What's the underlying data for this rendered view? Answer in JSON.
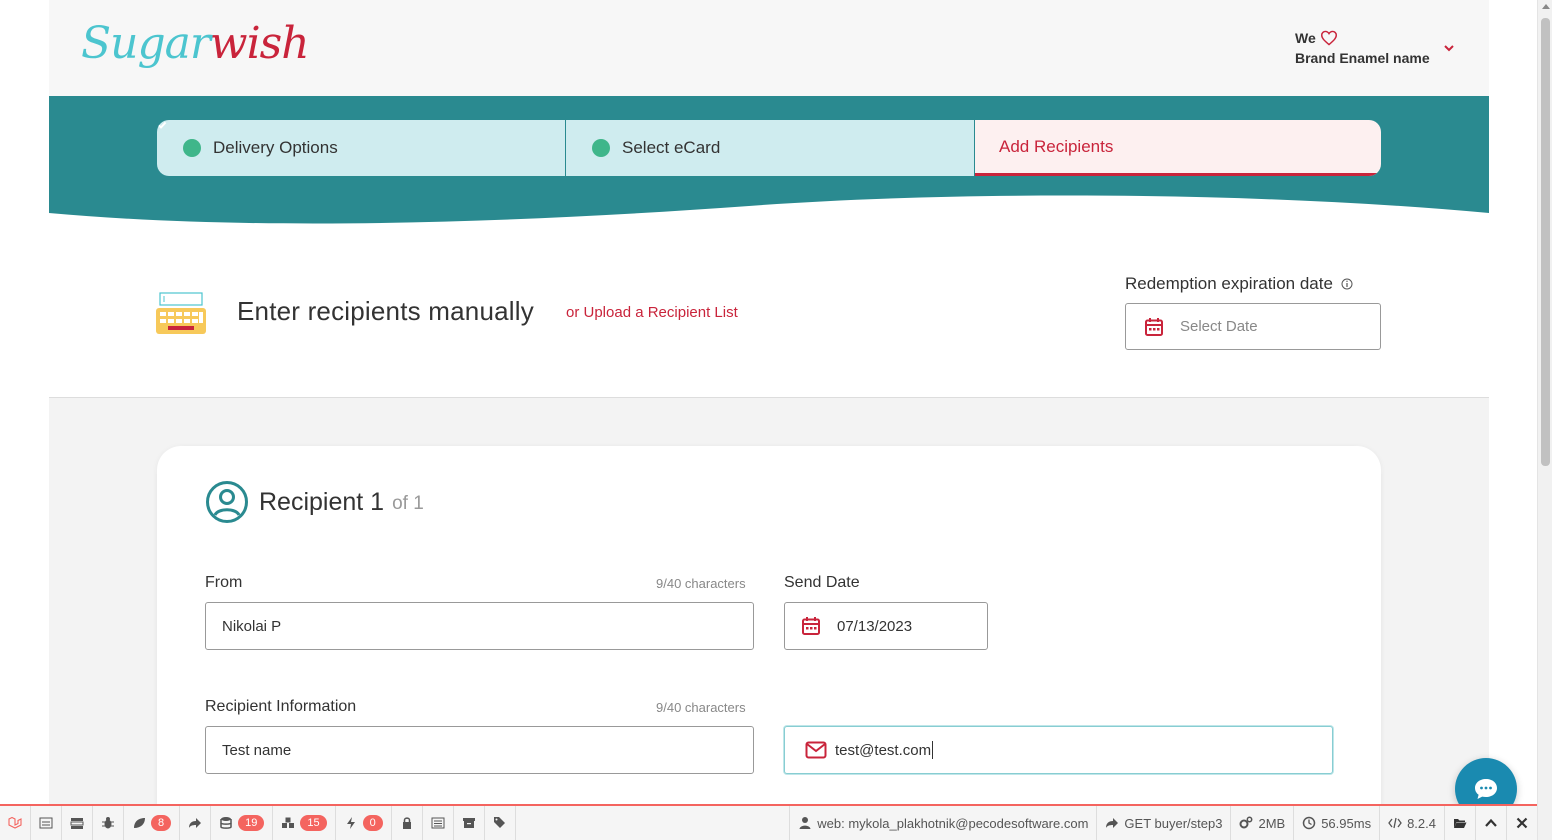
{
  "logo": {
    "part1": "Sugar",
    "part2": "wish"
  },
  "user_menu": {
    "we": "We",
    "brand": "Brand Enamel name"
  },
  "steps": [
    {
      "label": "Delivery Options",
      "done": true
    },
    {
      "label": "Select eCard",
      "done": true
    },
    {
      "label": "Add Recipients",
      "done": false,
      "active": true
    }
  ],
  "manual": {
    "title": "Enter recipients manually",
    "upload_link": "or Upload a Recipient List",
    "expiration_label": "Redemption expiration date",
    "expiration_placeholder": "Select Date"
  },
  "recipient": {
    "title": "Recipient 1",
    "of": "of 1",
    "from_label": "From",
    "from_count": "9/40 characters",
    "from_value": "Nikolai P",
    "send_date_label": "Send Date",
    "send_date_value": "07/13/2023",
    "info_label": "Recipient Information",
    "info_count": "9/40 characters",
    "name_value": "Test name",
    "email_value": "test@test.com"
  },
  "debugbar": {
    "badges": [
      "8",
      "19",
      "15",
      "0"
    ],
    "user": "web: mykola_plakhotnik@pecodesoftware.com",
    "route": "GET buyer/step3",
    "memory": "2MB",
    "time": "56.95ms",
    "version": "8.2.4"
  },
  "colors": {
    "teal": "#2a8a90",
    "brand_red": "#c9243b",
    "light_teal": "#cfecef"
  }
}
